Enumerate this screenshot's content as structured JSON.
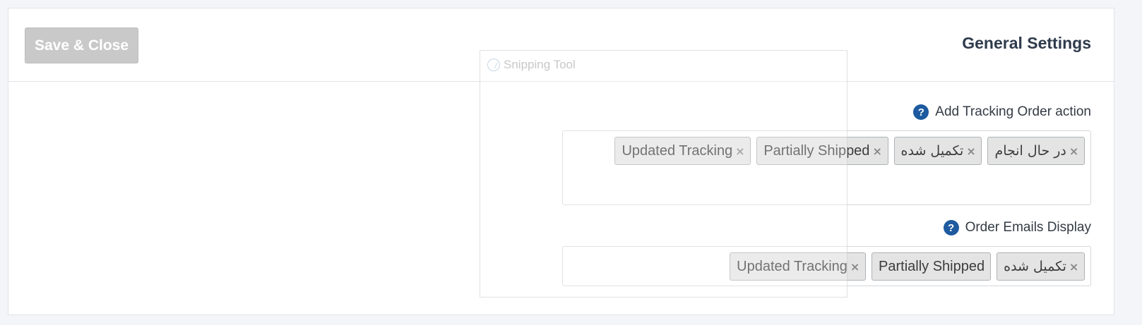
{
  "header": {
    "save_label": "Save & Close",
    "title": "General Settings"
  },
  "fields": [
    {
      "label": "Add Tracking Order action",
      "help_icon": "?",
      "tags": [
        {
          "label": "در حال انجام",
          "remove": "×"
        },
        {
          "label": "تکمیل شده",
          "remove": "×"
        },
        {
          "label": "Partially Shipped",
          "remove": "×"
        },
        {
          "label": "Updated Tracking",
          "remove": "×"
        }
      ]
    },
    {
      "label": "Order Emails Display",
      "help_icon": "?",
      "tags": [
        {
          "label": "تکمیل شده",
          "remove": "×"
        },
        {
          "label": "Partially Shipped"
        },
        {
          "label": "Updated Tracking",
          "remove": "×"
        }
      ]
    }
  ],
  "overlay": {
    "title": "Snipping Tool",
    "icon": "snipping-tool-icon"
  },
  "colors": {
    "help_icon": "#1d5aa0",
    "button_disabled": "#c9c9c9",
    "tag_bg": "#e4e4e4"
  }
}
